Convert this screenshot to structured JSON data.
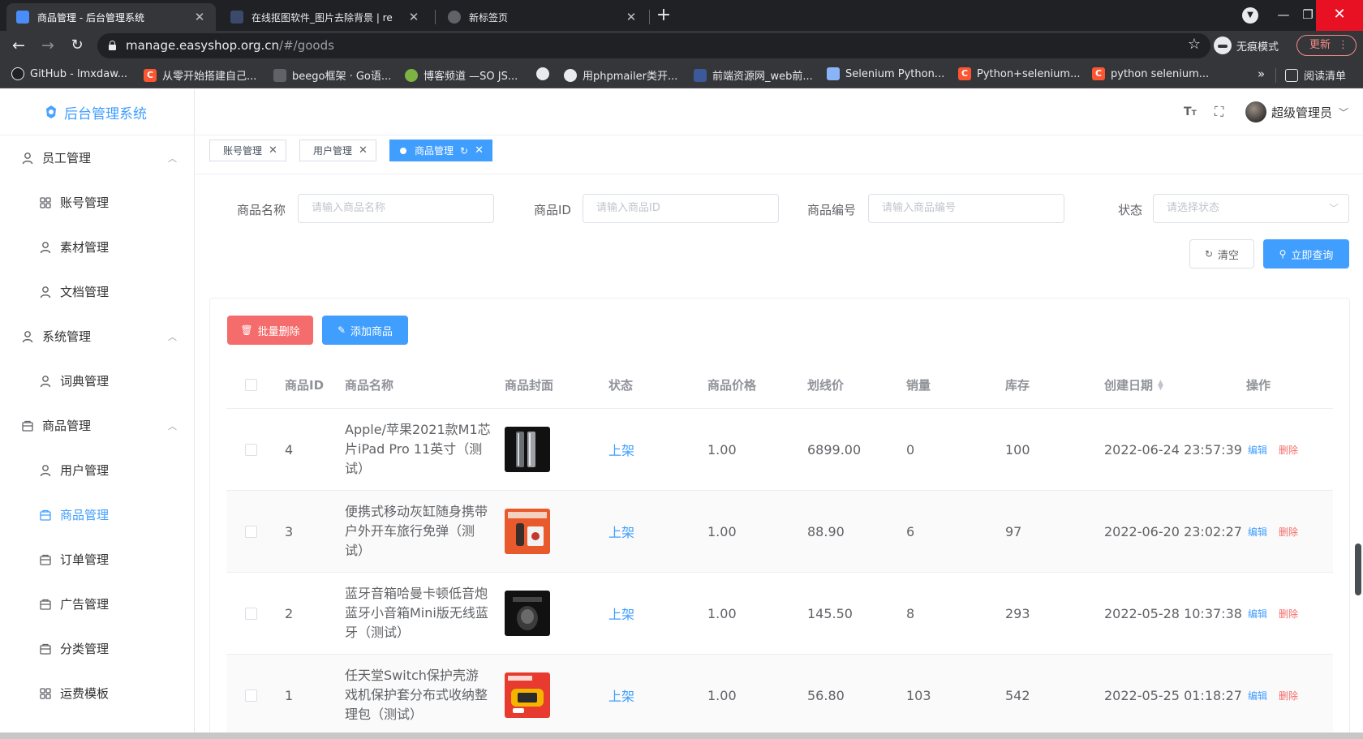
{
  "browser": {
    "tabs": [
      {
        "title": "商品管理 - 后台管理系统",
        "active": true
      },
      {
        "title": "在线抠图软件_图片去除背景 | re",
        "active": false
      },
      {
        "title": "新标签页",
        "active": false
      }
    ],
    "url_host": "manage.easyshop.org.cn",
    "url_path": "/#/goods",
    "incognito_label": "无痕模式",
    "update_label": "更新",
    "bookmarks": [
      "GitHub - lmxdaw...",
      "从零开始搭建自己...",
      "beego框架 · Go语...",
      "博客频道 —SO JS...",
      "",
      "用phpmailer类开...",
      "前端资源网_web前...",
      "Selenium Python...",
      "Python+selenium...",
      "python selenium..."
    ],
    "reading_list_label": "阅读清单"
  },
  "app": {
    "title": "后台管理系统",
    "user_name": "超级管理员",
    "menu": [
      {
        "label": "员工管理",
        "type": "group",
        "icon": "user-icon"
      },
      {
        "label": "账号管理",
        "type": "sub",
        "icon": "grid-icon"
      },
      {
        "label": "素材管理",
        "type": "sub",
        "icon": "user-icon"
      },
      {
        "label": "文档管理",
        "type": "sub",
        "icon": "user-icon"
      },
      {
        "label": "系统管理",
        "type": "group",
        "icon": "user-icon"
      },
      {
        "label": "词典管理",
        "type": "sub",
        "icon": "user-icon"
      },
      {
        "label": "商品管理",
        "type": "group",
        "icon": "box-icon"
      },
      {
        "label": "用户管理",
        "type": "sub",
        "icon": "user-icon"
      },
      {
        "label": "商品管理",
        "type": "sub",
        "icon": "box-icon",
        "active": true
      },
      {
        "label": "订单管理",
        "type": "sub",
        "icon": "box-icon"
      },
      {
        "label": "广告管理",
        "type": "sub",
        "icon": "box-icon"
      },
      {
        "label": "分类管理",
        "type": "sub",
        "icon": "box-icon"
      },
      {
        "label": "运费模板",
        "type": "sub",
        "icon": "grid-icon"
      }
    ],
    "tags": [
      {
        "label": "账号管理",
        "active": false
      },
      {
        "label": "用户管理",
        "active": false
      },
      {
        "label": "商品管理",
        "active": true
      }
    ],
    "filters": {
      "name_label": "商品名称",
      "name_placeholder": "请输入商品名称",
      "id_label": "商品ID",
      "id_placeholder": "请输入商品ID",
      "code_label": "商品编号",
      "code_placeholder": "请输入商品编号",
      "status_label": "状态",
      "status_placeholder": "请选择状态",
      "clear_label": "清空",
      "search_label": "立即查询"
    },
    "actions": {
      "batch_delete_label": "批量删除",
      "add_label": "添加商品"
    },
    "table": {
      "columns": [
        "商品ID",
        "商品名称",
        "商品封面",
        "状态",
        "商品价格",
        "划线价",
        "销量",
        "库存",
        "创建日期",
        "操作"
      ],
      "edit_label": "编辑",
      "delete_label": "删除",
      "rows": [
        {
          "id": "4",
          "name": "Apple/苹果2021款M1芯片iPad Pro 11英寸（测试）",
          "status": "上架",
          "price": "1.00",
          "original": "6899.00",
          "sales": "0",
          "stock": "100",
          "date": "2022-06-24 23:57:39",
          "thumb": "ipad"
        },
        {
          "id": "3",
          "name": "便携式移动灰缸随身携带户外开车旅行免弹（测试）",
          "status": "上架",
          "price": "1.00",
          "original": "88.90",
          "sales": "6",
          "stock": "97",
          "date": "2022-06-20 23:02:27",
          "thumb": "ashtray"
        },
        {
          "id": "2",
          "name": "蓝牙音箱哈曼卡顿低音炮蓝牙小音箱Mini版无线蓝牙（测试）",
          "status": "上架",
          "price": "1.00",
          "original": "145.50",
          "sales": "8",
          "stock": "293",
          "date": "2022-05-28 10:37:38",
          "thumb": "speaker"
        },
        {
          "id": "1",
          "name": "任天堂Switch保护壳游戏机保护套分布式收纳整理包（测试）",
          "status": "上架",
          "price": "1.00",
          "original": "56.80",
          "sales": "103",
          "stock": "542",
          "date": "2022-05-25 01:18:27",
          "thumb": "switch"
        }
      ]
    }
  }
}
